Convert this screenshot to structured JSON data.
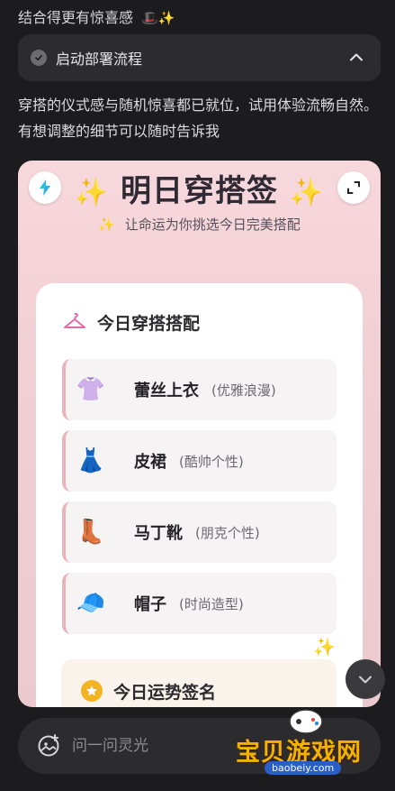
{
  "chat": {
    "top_line": "结合得更有惊喜感",
    "top_line_emoji": "🎩✨",
    "step": {
      "label": "启动部署流程",
      "expanded": true
    },
    "message": "穿搭的仪式感与随机惊喜都已就位，试用体验流畅自然。有想调整的细节可以随时告诉我"
  },
  "preview": {
    "title": "明日穿搭签",
    "subtitle": "让命运为你挑选今日完美搭配",
    "outfit_heading": "今日穿搭搭配",
    "items": [
      {
        "icon": "👚",
        "name": "蕾丝上衣",
        "tag": "(优雅浪漫)"
      },
      {
        "icon": "👗",
        "name": "皮裙",
        "tag": "(酷帅个性)"
      },
      {
        "icon": "👢",
        "name": "马丁靴",
        "tag": "(朋克个性)"
      },
      {
        "icon": "🧢",
        "name": "帽子",
        "tag": "(时尚造型)"
      }
    ],
    "fortune_heading": "今日运势签名"
  },
  "input": {
    "placeholder": "问一问灵光"
  },
  "watermark": {
    "text": "宝贝游戏网",
    "url": "baobeiy.com"
  },
  "colors": {
    "background": "#1c1c1e",
    "card": "#2c2c2f",
    "preview_pink": "#f1cfd4",
    "accent_gold": "#f2c744",
    "item_border": "#e9b3bd"
  }
}
